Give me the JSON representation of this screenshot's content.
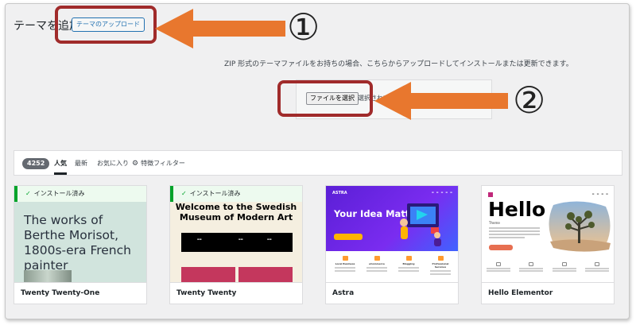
{
  "header": {
    "page_title": "テーマを追加",
    "upload_button_label": "テーマのアップロード"
  },
  "callouts": {
    "marker_1": "①",
    "marker_2": "②",
    "color": "#a02b2b",
    "arrow_color": "#e8772e"
  },
  "upload": {
    "info_text": "ZIP 形式のテーマファイルをお持ちの場合、こちらからアップロードしてインストールまたは更新できます。",
    "choose_file_label": "ファイルを選択",
    "file_status": "選択されてい"
  },
  "filter_bar": {
    "count": "4252",
    "tabs": [
      {
        "label": "人気",
        "active": true
      },
      {
        "label": "最新",
        "active": false
      },
      {
        "label": "お気に入り",
        "active": false
      },
      {
        "label": "特徴フィルター",
        "active": false,
        "icon": "gear-icon"
      }
    ]
  },
  "themes": [
    {
      "name": "Twenty Twenty-One",
      "installed": true,
      "installed_label": "インストール済み",
      "preview_headline": "The works of Berthe Morisot, 1800s-era French painter"
    },
    {
      "name": "Twenty Twenty",
      "installed": true,
      "installed_label": "インストール済み",
      "preview_headline": "Welcome to the Swedish Museum of Modern Art"
    },
    {
      "name": "Astra",
      "installed": false,
      "preview_logo": "ASTRA",
      "preview_headline": "Your Idea Matters!",
      "preview_features": [
        "Local Business",
        "eCommerce",
        "Blogging",
        "Professional Services"
      ]
    },
    {
      "name": "Hello Elementor",
      "installed": false,
      "preview_headline": "Hello",
      "preview_sub": "Theme"
    }
  ]
}
